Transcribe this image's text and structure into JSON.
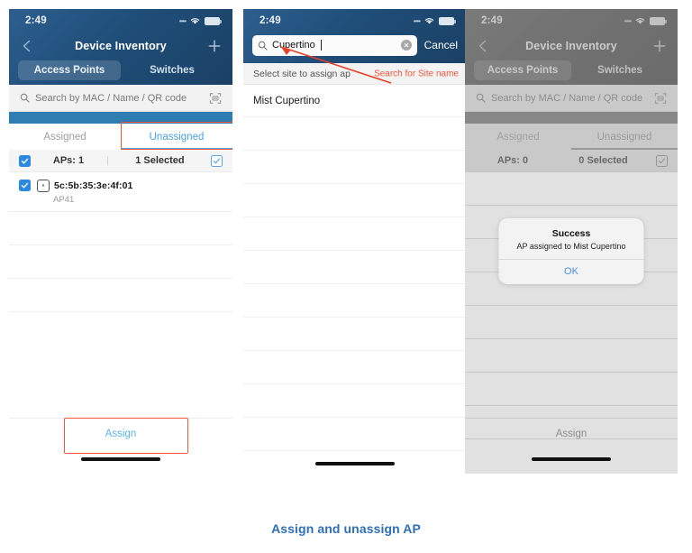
{
  "caption": "Assign and unassign AP",
  "colors": {
    "nav_blue": "#1f4e79",
    "accent_blue": "#4a9fe0",
    "annotation_red": "#f4563c",
    "caption_blue": "#2e6fb7",
    "checkbox_blue": "#2b8ae0"
  },
  "screens": [
    {
      "id": "device-inventory-unassigned",
      "statusbar": {
        "time": "2:49",
        "wifi_icon": "wifi-icon",
        "battery_icon": "battery-icon"
      },
      "nav": {
        "back_icon": "chevron-left-icon",
        "title": "Device Inventory",
        "add_icon": "plus-icon"
      },
      "segments": [
        {
          "label": "Access Points",
          "active": true
        },
        {
          "label": "Switches",
          "active": false
        }
      ],
      "search": {
        "icon": "search-icon",
        "placeholder": "Search by MAC / Name / QR code",
        "value": "",
        "scan_icon": "qr-scan-icon"
      },
      "tabs": [
        {
          "label": "Assigned",
          "selected": false
        },
        {
          "label": "Unassigned",
          "selected": true
        }
      ],
      "count_bar": {
        "select_all_checkbox": "checked",
        "aps_label": "APs: 1",
        "divider": "|",
        "selected_label": "1 Selected",
        "right_checkbox_icon": "checkbox-outline-checked-icon"
      },
      "devices": [
        {
          "checked": true,
          "device_icon": "access-point-icon",
          "mac": "5c:5b:35:3e:4f:01",
          "model": "AP41"
        }
      ],
      "empty_rows": 3,
      "assign_button": {
        "label": "Assign",
        "enabled": true,
        "highlighted": true
      },
      "home_indicator": "home-indicator"
    },
    {
      "id": "site-search",
      "statusbar": {
        "time": "2:49",
        "wifi_icon": "wifi-icon",
        "battery_icon": "battery-icon"
      },
      "search_field": {
        "icon": "search-icon",
        "value": "Cupertino",
        "placeholder": "Search",
        "clear_icon": "clear-circle-icon",
        "cancel_label": "Cancel"
      },
      "hint": "Select site to assign ap",
      "annotation": "Search for  Site name",
      "sites": [
        "Mist Cupertino"
      ],
      "empty_rows": 11,
      "home_indicator": "home-indicator"
    },
    {
      "id": "assign-success",
      "statusbar": {
        "time": "2:49",
        "wifi_icon": "wifi-icon",
        "battery_icon": "battery-icon"
      },
      "nav": {
        "back_icon": "chevron-left-icon",
        "title": "Device Inventory",
        "add_icon": "plus-icon"
      },
      "segments": [
        {
          "label": "Access Points",
          "active": true
        },
        {
          "label": "Switches",
          "active": false
        }
      ],
      "search": {
        "icon": "search-icon",
        "placeholder": "Search by MAC / Name / QR code",
        "value": "",
        "scan_icon": "qr-scan-icon"
      },
      "tabs": [
        {
          "label": "Assigned",
          "selected": false
        },
        {
          "label": "Unassigned",
          "selected": true
        }
      ],
      "count_bar": {
        "aps_label": "APs: 0",
        "selected_label": "0 Selected",
        "right_checkbox_icon": "checkbox-outline-icon"
      },
      "empty_rows": 8,
      "alert": {
        "title": "Success",
        "message": "AP assigned to Mist Cupertino",
        "ok_label": "OK"
      },
      "assign_button": {
        "label": "Assign",
        "enabled": false,
        "highlighted": false
      },
      "home_indicator": "home-indicator"
    }
  ]
}
